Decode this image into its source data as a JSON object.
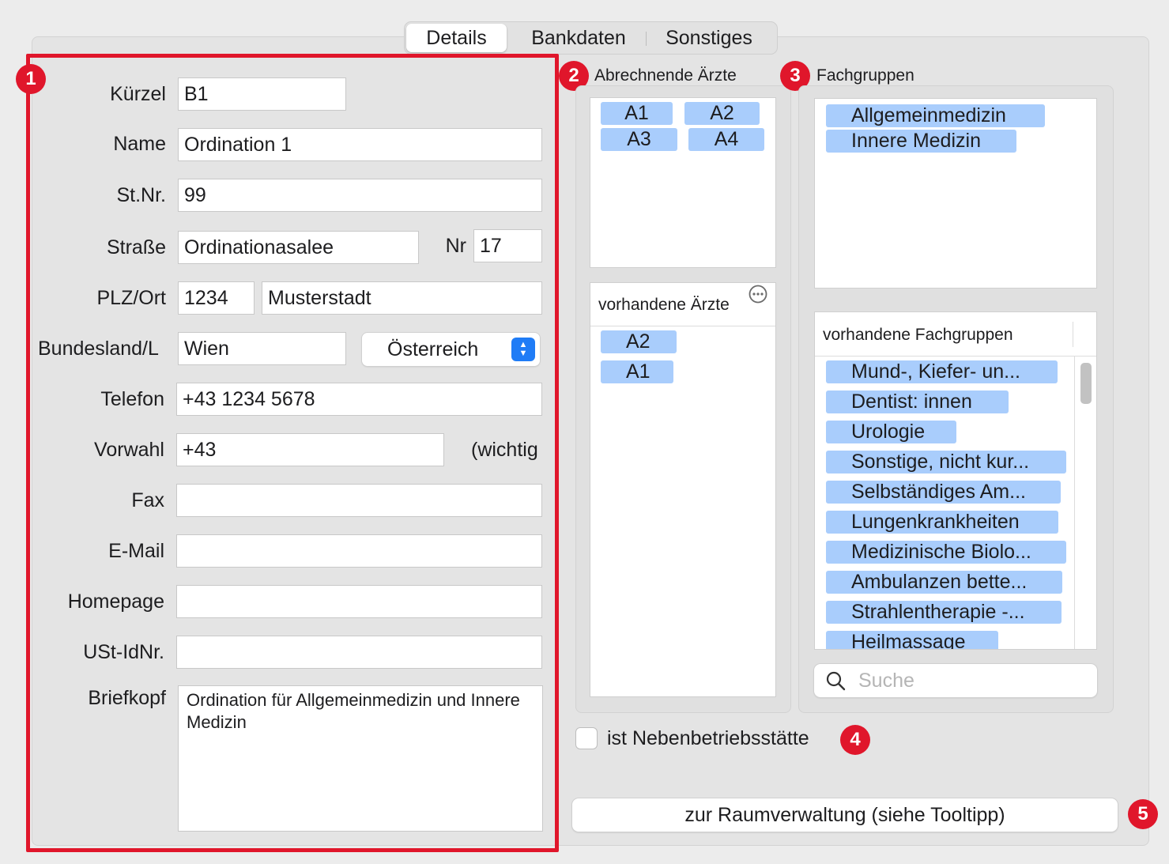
{
  "tabs": [
    {
      "label": "Details",
      "active": true
    },
    {
      "label": "Bankdaten",
      "active": false
    },
    {
      "label": "Sonstiges",
      "active": false
    }
  ],
  "badges": [
    "1",
    "2",
    "3",
    "4",
    "5"
  ],
  "form": {
    "kuerzel": {
      "label": "Kürzel",
      "value": "B1"
    },
    "name": {
      "label": "Name",
      "value": "Ordination 1"
    },
    "stnr": {
      "label": "St.Nr.",
      "value": "99"
    },
    "strasse": {
      "label": "Straße",
      "value": "Ordinationasalee",
      "nr_label": "Nr",
      "nr_value": "17"
    },
    "plzort": {
      "label": "PLZ/Ort",
      "plz": "1234",
      "ort": "Musterstadt"
    },
    "bundesland": {
      "label": "Bundesland/L",
      "value": "Wien",
      "country": "Österreich"
    },
    "telefon": {
      "label": "Telefon",
      "value": "+43 1234 5678"
    },
    "vorwahl": {
      "label": "Vorwahl",
      "value": "+43",
      "hint": "(wichtig"
    },
    "fax": {
      "label": "Fax",
      "value": ""
    },
    "email": {
      "label": "E-Mail",
      "value": ""
    },
    "homepage": {
      "label": "Homepage",
      "value": ""
    },
    "ustid": {
      "label": "USt-IdNr.",
      "value": ""
    },
    "briefkopf": {
      "label": "Briefkopf",
      "value": "Ordination für Allgemeinmedizin und Innere Medizin"
    }
  },
  "aerzte": {
    "title": "Abrechnende Ärzte",
    "selected": [
      "A1",
      "A2",
      "A3",
      "A4"
    ],
    "available_header": "vorhandene Ärzte",
    "available": [
      "A2",
      "A1"
    ]
  },
  "fachgruppen": {
    "title": "Fachgruppen",
    "selected": [
      "Allgemeinmedizin",
      "Innere Medizin"
    ],
    "available_header": "vorhandene Fachgruppen",
    "available": [
      "Mund-, Kiefer- un...",
      "Dentist: innen",
      "Urologie",
      "Sonstige, nicht kur...",
      "Selbständiges Am...",
      "Lungenkrankheiten",
      "Medizinische Biolo...",
      "Ambulanzen bette...",
      "Strahlentherapie -...",
      "Heilmassage"
    ],
    "search_placeholder": "Suche"
  },
  "nebenbetrieb": {
    "label": "ist Nebenbetriebsstätte",
    "checked": false
  },
  "raumverwaltung_button": "zur Raumverwaltung (siehe Tooltipp)",
  "colors": {
    "accent": "#e0162b",
    "token": "#a9cdfc",
    "select_blue": "#1f7cf6"
  }
}
